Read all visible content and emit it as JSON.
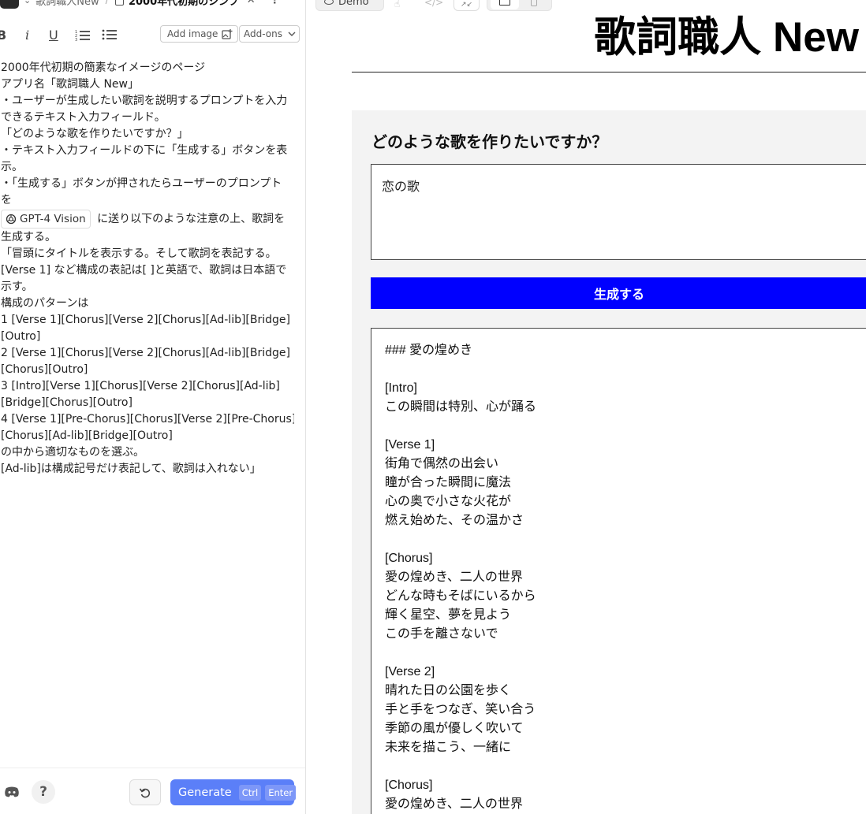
{
  "editor": {
    "breadcrumb": {
      "app_name": "歌詞職人New",
      "doc_title": "2000年代初期のシンプ"
    },
    "toolbar": {
      "bold": "B",
      "italic": "i",
      "underline": "U",
      "add_image_label": "Add image",
      "addons_label": "Add-ons"
    },
    "prompt_lines": [
      "2000年代初期の簡素なイメージのページ",
      "アプリ名「歌詞職人 New」",
      "・ユーザーが生成したい歌詞を説明するプロンプトを入力",
      "できるテキスト入力フィールド。",
      "「どのような歌を作りたいですか？」",
      "・テキスト入力フィールドの下に「生成する」ボタンを表",
      "示。",
      "・「生成する」ボタンが押されたらユーザーのプロンプト",
      "を"
    ],
    "model_chip": "GPT-4 Vision",
    "prompt_line_after_chip": "に送り以下のような注意の上、歌詞を",
    "prompt_lines_2": [
      "生成する。",
      "「冒頭にタイトルを表示する。そして歌詞を表記する。",
      "[Verse 1] など構成の表記は[ ]と英語で、歌詞は日本語で",
      "示す。",
      "構成のパターンは",
      "1 [Verse 1][Chorus][Verse 2][Chorus][Ad-lib][Bridge]",
      "[Outro]",
      "2 [Verse 1][Chorus][Verse 2][Chorus][Ad-lib][Bridge]",
      "[Chorus][Outro]",
      "3 [Intro][Verse 1][Chorus][Verse 2][Chorus][Ad-lib]",
      "[Bridge][Chorus][Outro]",
      "4 [Verse 1][Pre-Chorus][Chorus][Verse 2][Pre-Chorus]",
      "[Chorus][Ad-lib][Bridge][Outro]",
      "の中から適切なものを選ぶ。",
      "[Ad-lib]は構成記号だけ表記して、歌詞は入れない」"
    ],
    "footer": {
      "help_label": "?",
      "generate_label": "Generate",
      "shortcut_ctrl": "Ctrl",
      "shortcut_enter": "Enter"
    }
  },
  "preview": {
    "toolbar": {
      "demo_label": "Demo"
    },
    "page": {
      "heading": "歌詞職人 New",
      "question": "どのような歌を作りたいですか？",
      "input_value": "恋の歌",
      "button_label": "生成する",
      "output_lines": [
        "### 愛の煌めき",
        "",
        "[Intro]",
        "この瞬間は特別、心が踊る",
        "",
        "[Verse 1]",
        "街角で偶然の出会い",
        "瞳が合った瞬間に魔法",
        "心の奥で小さな火花が",
        "燃え始めた、その温かさ",
        "",
        "[Chorus]",
        "愛の煌めき、二人の世界",
        "どんな時もそばにいるから",
        "輝く星空、夢を見よう",
        "この手を離さないで",
        "",
        "[Verse 2]",
        "晴れた日の公園を歩く",
        "手と手をつなぎ、笑い合う",
        "季節の風が優しく吹いて",
        "未来を描こう、一緒に",
        "",
        "[Chorus]",
        "愛の煌めき、二人の世界"
      ]
    }
  },
  "colors": {
    "generate_button": "#0000ff",
    "editor_generate": "#5b7ff8",
    "form_background": "#f3f3f3"
  }
}
